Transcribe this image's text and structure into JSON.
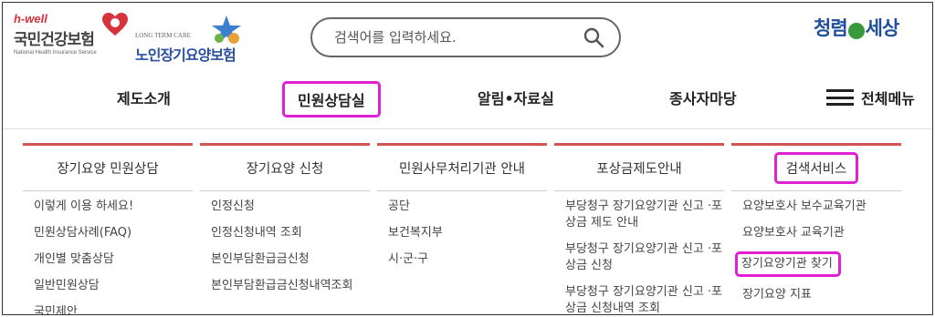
{
  "header": {
    "logo1": {
      "tag": "h-well",
      "name": "국민건강보험",
      "sub": "National Health Insurance Service"
    },
    "logo2": {
      "sub": "LONG TERM CARE",
      "name": "노인장기요양보험"
    },
    "search": {
      "placeholder": "검색어를 입력하세요."
    },
    "slogan": {
      "left": "청렴",
      "right": "세상"
    }
  },
  "nav": {
    "items": [
      "제도소개",
      "민원상담실",
      "알림•자료실",
      "종사자마당"
    ],
    "all_menu": "전체메뉴",
    "active": "민원상담실"
  },
  "columns": [
    {
      "title": "장기요양 민원상담",
      "items": [
        "이렇게 이용 하세요!",
        "민원상담사례(FAQ)",
        "개인별 맞춤상담",
        "일반민원상담",
        "국민제안"
      ]
    },
    {
      "title": "장기요양 신청",
      "items": [
        "인정신청",
        "인정신청내역 조회",
        "본인부담환급금신청",
        "본인부담환급금신청내역조회"
      ]
    },
    {
      "title": "민원사무처리기관 안내",
      "items": [
        "공단",
        "보건복지부",
        "시·군·구"
      ]
    },
    {
      "title": "포상금제도안내",
      "items": [
        "부당청구 장기요양기관 신고 ·포상금 제도 안내",
        "부당청구 장기요양기관 신고 ·포상금 신청",
        "부당청구 장기요양기관 신고 ·포상금 신청내역 조회"
      ]
    },
    {
      "title": "검색서비스",
      "items": [
        "요양보호사 보수교육기관",
        "요양보호사 교육기관",
        "장기요양기관 찾기",
        "장기요양 지표"
      ]
    }
  ],
  "colors": {
    "highlight": "#e11fd3",
    "column_bar": "#d65353",
    "brand_blue": "#1f4e9c"
  }
}
